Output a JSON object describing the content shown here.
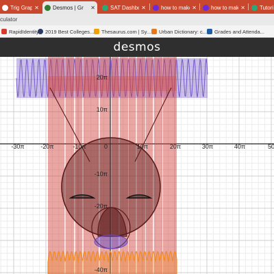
{
  "tabs": [
    {
      "label": "Trig Graphing",
      "icon": "desmos-favicon-icon",
      "color": "#ffffff",
      "active": false
    },
    {
      "label": "Desmos | Gr",
      "icon": "desmos-favicon-icon",
      "color": "#ffffff",
      "active": true
    },
    {
      "label": "SAT Dashbo",
      "icon": "college-board-favicon-icon",
      "color": "#2aa876",
      "active": false
    },
    {
      "label": "how to make",
      "icon": "yahoo-favicon-icon",
      "color": "#6c2bd9",
      "active": false
    },
    {
      "label": "how to make",
      "icon": "yahoo-favicon-icon",
      "color": "#6c2bd9",
      "active": false
    },
    {
      "label": "Tutori",
      "icon": "tutorial-favicon-icon",
      "color": "#2aa876",
      "active": false
    }
  ],
  "address": {
    "text": "culator"
  },
  "bookmarks": [
    {
      "label": "RapidIdentity",
      "icon": "rapididentity-icon",
      "color": "#d43b2b"
    },
    {
      "label": "2019 Best Colleges...",
      "icon": "best-colleges-icon",
      "color": "#2b3a67"
    },
    {
      "label": "Thesaurus.com | Sy...",
      "icon": "thesaurus-icon",
      "color": "#f0a000"
    },
    {
      "label": "Urban Dictionary: c...",
      "icon": "urban-dictionary-icon",
      "color": "#e8761b"
    },
    {
      "label": "Grades and Attenda...",
      "icon": "sis-icon",
      "color": "#1b5fa8"
    }
  ],
  "app": {
    "logo": "desmos"
  },
  "graph": {
    "x_ticks": [
      "-30π",
      "-20π",
      "-10π",
      "0",
      "10π",
      "20π",
      "30π",
      "40π",
      "50"
    ],
    "y_ticks": [
      "20π",
      "10π",
      "-10π",
      "-20π",
      "-40π"
    ],
    "colors": {
      "purple": "#6a4bc4",
      "red": "#d24a44",
      "dark_red": "#5a1a1a",
      "orange": "#f08a24",
      "black": "#111111"
    }
  }
}
